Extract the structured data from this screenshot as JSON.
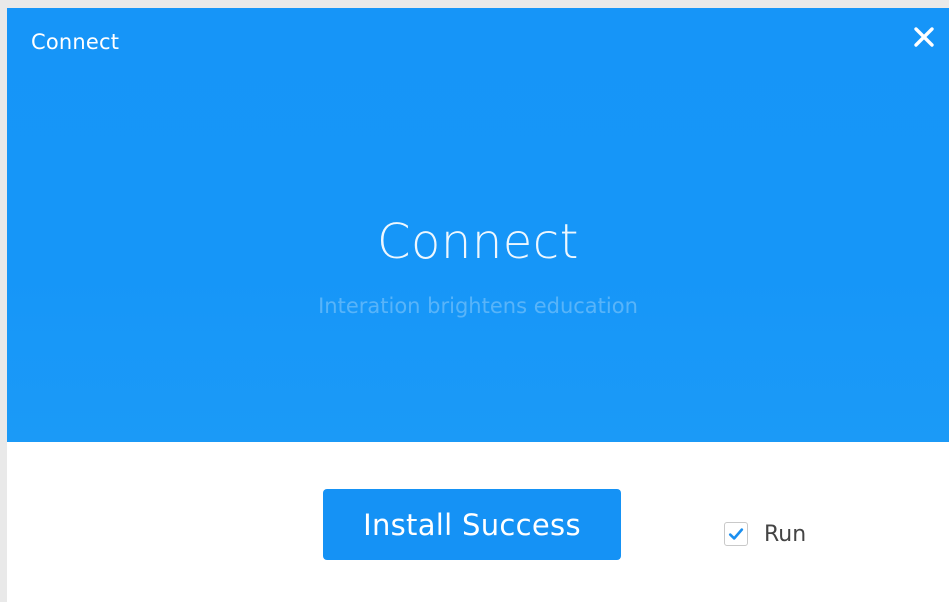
{
  "window": {
    "title": "Connect"
  },
  "banner": {
    "app_name": "Connect",
    "tagline": "Interation brightens education",
    "close_icon": "close-icon"
  },
  "footer": {
    "install_button_label": "Install Success",
    "run_checkbox": {
      "label": "Run",
      "checked": true,
      "check_icon": "checkmark-icon"
    }
  },
  "colors": {
    "banner_blue": "#1695f8",
    "button_blue": "#1592f5",
    "checkmark_blue": "#1a8ff0",
    "background": "#ffffff"
  }
}
